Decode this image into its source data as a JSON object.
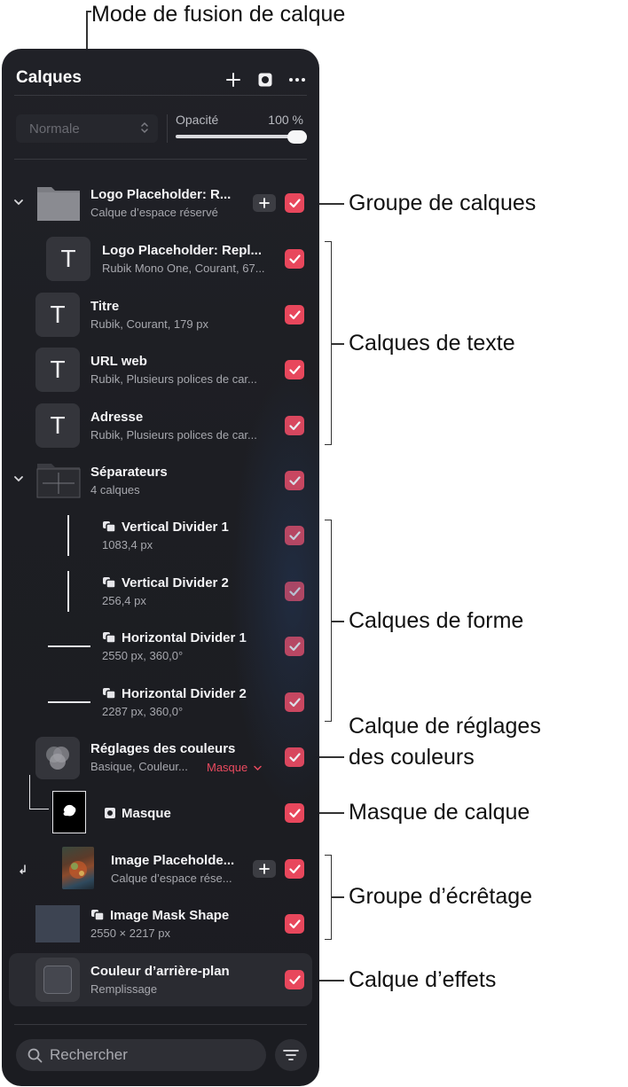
{
  "panel": {
    "title": "Calques",
    "blend_mode": "Normale",
    "opacity_label": "Opacité",
    "opacity_value": "100 %",
    "opacity_fraction": 1.0,
    "search_placeholder": "Rechercher"
  },
  "layers": {
    "logo_group": {
      "name": "Logo Placeholder: R...",
      "sub": "Calque d’espace réservé"
    },
    "logo_text": {
      "name": "Logo Placeholder: Repl...",
      "sub": "Rubik Mono One, Courant, 67..."
    },
    "titre": {
      "name": "Titre",
      "sub": "Rubik, Courant, 179 px"
    },
    "url": {
      "name": "URL web",
      "sub": "Rubik, Plusieurs polices de car..."
    },
    "adresse": {
      "name": "Adresse",
      "sub": "Rubik, Plusieurs polices de car..."
    },
    "separateurs": {
      "name": "Séparateurs",
      "sub": "4 calques"
    },
    "vdiv1": {
      "name": "Vertical Divider 1",
      "sub": "1083,4 px"
    },
    "vdiv2": {
      "name": "Vertical Divider 2",
      "sub": "256,4 px"
    },
    "hdiv1": {
      "name": "Horizontal Divider 1",
      "sub": "2550 px, 360,0°"
    },
    "hdiv2": {
      "name": "Horizontal Divider 2",
      "sub": "2287 px, 360,0°"
    },
    "color_adj": {
      "name": "Réglages des couleurs",
      "sub": "Basique, Couleur...",
      "mask_link": "Masque"
    },
    "mask": {
      "name": "Masque"
    },
    "image_ph": {
      "name": "Image Placeholde...",
      "sub": "Calque d’espace rése..."
    },
    "image_mask": {
      "name": "Image Mask Shape",
      "sub": "2550 × 2217 px"
    },
    "bg_color": {
      "name": "Couleur d’arrière-plan",
      "sub": "Remplissage"
    }
  },
  "callouts": {
    "blend_mode": "Mode de fusion de calque",
    "layer_group": "Groupe de calques",
    "text_layers": "Calques de texte",
    "shape_layers": "Calques de forme",
    "color_adj_line1": "Calque de réglages",
    "color_adj_line2": "des couleurs",
    "layer_mask": "Masque de calque",
    "clipping_group": "Groupe d’écrêtage",
    "effects_layer": "Calque d’effets"
  },
  "colors": {
    "panel_bg": "#1d1e23",
    "checkbox": "#e8475c",
    "accent_link": "#ea4a5f"
  },
  "icons": [
    "plus-icon",
    "mask-icon",
    "more-icon",
    "chevron-down-icon",
    "folder-icon",
    "text-icon",
    "shape-icon",
    "search-icon",
    "filter-icon",
    "checkmark-icon",
    "clip-arrow-icon"
  ]
}
